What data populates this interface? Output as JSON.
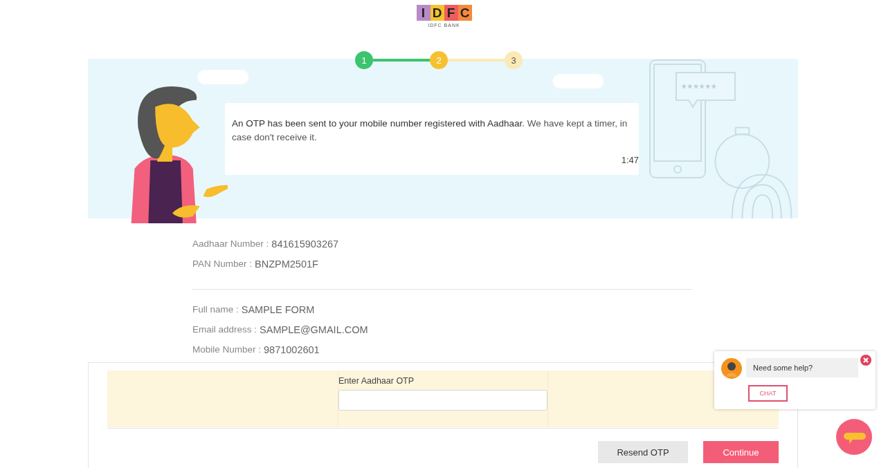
{
  "logo": {
    "letters": [
      "I",
      "D",
      "F",
      "C"
    ],
    "caption": "IDFC BANK"
  },
  "steps": [
    {
      "number": "1",
      "completed": true,
      "selected": false
    },
    {
      "number": "2",
      "completed": false,
      "selected": true
    },
    {
      "number": "3",
      "completed": false,
      "selected": false
    }
  ],
  "banner": {
    "message": "**An OTP has been sent to your mobile number registered with Aadhaar**. We have kept a timer, in case don't receive it.",
    "timer": "1:47",
    "code_mask": "******"
  },
  "identity": [
    {
      "label": "Aadhaar Number :",
      "value": "841615903267"
    },
    {
      "label": "PAN Number :",
      "value": "BNZPM2501F"
    }
  ],
  "contact": [
    {
      "label": "Full name :",
      "value": "SAMPLE FORM"
    },
    {
      "label": "Email address :",
      "value": "SAMPLE@GMAIL.COM"
    },
    {
      "label": "Mobile Number :",
      "value": "9871002601"
    }
  ],
  "otp_field": {
    "label": "Enter Aadhaar OTP"
  },
  "buttons": [
    {
      "label": "Resend OTP",
      "kind": "secondary"
    },
    {
      "label": "Continue",
      "kind": "primary"
    }
  ],
  "chat_popup": {
    "message": "Need some help?",
    "button": "CHAT"
  }
}
